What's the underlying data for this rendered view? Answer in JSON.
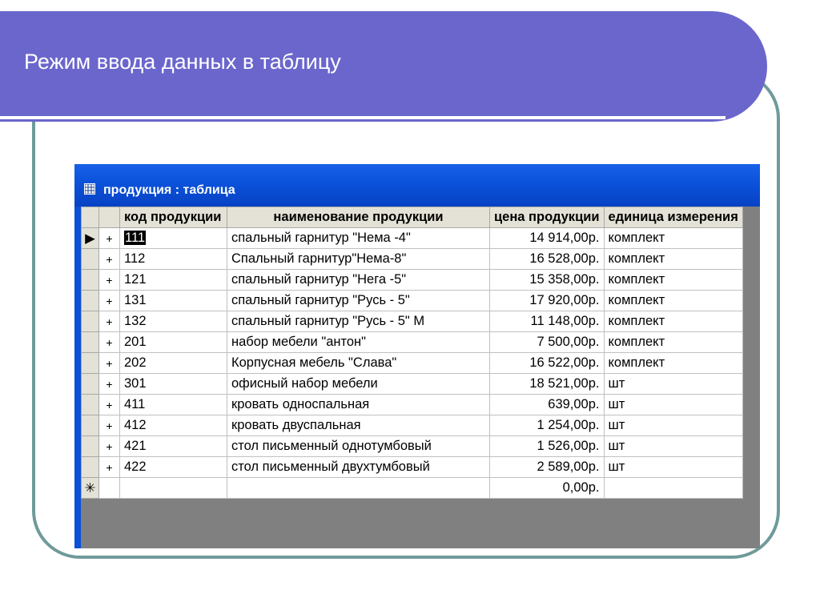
{
  "slide": {
    "title": "Режим ввода данных в таблицу"
  },
  "window": {
    "title": "продукция : таблица",
    "icon": "table-icon"
  },
  "table": {
    "columns": [
      "код продукции",
      "наименование продукции",
      "цена продукции",
      "единица измерения"
    ],
    "rows": [
      {
        "code": "111",
        "name": "спальный гарнитур \"Нема -4\"",
        "price": "14 914,00р.",
        "unit": "комплект"
      },
      {
        "code": "112",
        "name": "Спальный гарнитур\"Нема-8\"",
        "price": "16 528,00р.",
        "unit": "комплект"
      },
      {
        "code": "121",
        "name": "спальный гарнитур \"Нега -5\"",
        "price": "15 358,00р.",
        "unit": "комплект"
      },
      {
        "code": "131",
        "name": "спальный гарнитур \"Русь - 5\"",
        "price": "17 920,00р.",
        "unit": "комплект"
      },
      {
        "code": "132",
        "name": "спальный гарнитур \"Русь - 5\" М",
        "price": "11 148,00р.",
        "unit": "комплект"
      },
      {
        "code": "201",
        "name": "набор мебели \"антон\"",
        "price": "7 500,00р.",
        "unit": "комплект"
      },
      {
        "code": "202",
        "name": "Корпусная мебель \"Слава\"",
        "price": "16 522,00р.",
        "unit": "комплект"
      },
      {
        "code": "301",
        "name": "офисный набор мебели",
        "price": "18 521,00р.",
        "unit": "шт"
      },
      {
        "code": "411",
        "name": "кровать односпальная",
        "price": "639,00р.",
        "unit": "шт"
      },
      {
        "code": "412",
        "name": "кровать двуспальная",
        "price": "1 254,00р.",
        "unit": "шт"
      },
      {
        "code": "421",
        "name": "стол письменный однотумбовый",
        "price": "1 526,00р.",
        "unit": "шт"
      },
      {
        "code": "422",
        "name": "стол письменный двухтумбовый",
        "price": "2 589,00р.",
        "unit": "шт"
      }
    ],
    "new_row": {
      "marker": "✳",
      "price": "0,00р."
    },
    "expand_symbol": "+",
    "current_row_marker": "▶"
  }
}
